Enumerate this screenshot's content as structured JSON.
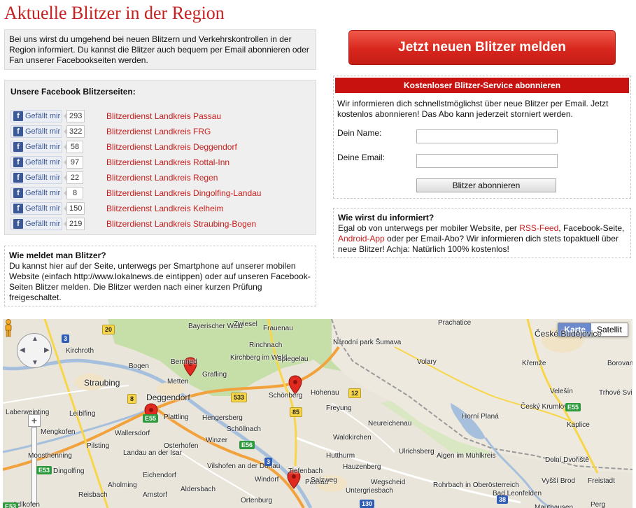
{
  "page": {
    "title": "Aktuelle Blitzer in der Region",
    "intro": "Bei uns wirst du umgehend bei neuen Blitzern und Verkehrskontrollen in der Region informiert. Du kannst die Blitzer auch bequem per Email abonnieren oder Fan unserer Facebookseiten werden."
  },
  "facebook": {
    "heading": "Unsere Facebook Blitzerseiten:",
    "like_label": "Gefällt mir",
    "pages": [
      {
        "count": "293",
        "name": "Blitzerdienst Landkreis Passau"
      },
      {
        "count": "322",
        "name": "Blitzerdienst Landkreis FRG"
      },
      {
        "count": "58",
        "name": "Blitzerdienst Landkreis Deggendorf"
      },
      {
        "count": "97",
        "name": "Blitzerdienst Landkreis Rottal-Inn"
      },
      {
        "count": "22",
        "name": "Blitzerdienst Landkreis Regen"
      },
      {
        "count": "8",
        "name": "Blitzerdienst Landkreis Dingolfing-Landau"
      },
      {
        "count": "150",
        "name": "Blitzerdienst Landkreis Kelheim"
      },
      {
        "count": "219",
        "name": "Blitzerdienst Landkreis Straubing-Bogen"
      }
    ]
  },
  "how_report": {
    "heading": "Wie meldet man Blitzer?",
    "text": "Du kannst hier auf der Seite, unterwegs per Smartphone auf unserer mobilen Website (einfach http://www.lokalnews.de eintippen) oder auf unseren Facebook-Seiten Blitzer melden. Die Blitzer werden nach einer kurzen Prüfung freigeschaltet."
  },
  "report_button": "Jetzt neuen Blitzer melden",
  "subscribe": {
    "header": "Kostenloser Blitzer-Service abonnieren",
    "text": "Wir informieren dich schnellstmöglichst über neue Blitzer per Email. Jetzt kostenlos abonnieren! Das Abo kann jederzeit storniert werden.",
    "name_label": "Dein Name:",
    "email_label": "Deine Email:",
    "name_value": "",
    "email_value": "",
    "button": "Blitzer abonnieren"
  },
  "info": {
    "heading": "Wie wirst du informiert?",
    "text_1": "Egal ob von unterwegs per mobiler Website, per ",
    "link_rss": "RSS-Feed",
    "text_2": ", Facebook-Seite, ",
    "link_app": "Android-App",
    "text_3": " oder per Email-Abo? Wir informieren dich stets topaktuell über neue Blitzer! Achja: Natürlich 100% kostenlos!"
  },
  "map": {
    "type_map": "Karte",
    "type_satellite": "Satellit",
    "places": [
      "Straubing",
      "Deggendorf",
      "Passau",
      "Bogen",
      "Kirchroth",
      "Bayerischer Wald",
      "Zwiesel",
      "Frauenau",
      "Rinchnach",
      "Kirchberg im Wald",
      "Spiegelau",
      "Grafling",
      "Bernried",
      "Metten",
      "Schönberg",
      "Hohenau",
      "Freyung",
      "Plattling",
      "Hengersberg",
      "Schöllnach",
      "Winzer",
      "Osterhofen",
      "Wallersdorf",
      "Landau an der Isar",
      "Eichendorf",
      "Dingolfing",
      "Pilsting",
      "Mengkofen",
      "Leiblfing",
      "Laberweinting",
      "Moosthenning",
      "Vilshofen an der Donau",
      "Windorf",
      "Tiefenbach",
      "Salzweg",
      "Hutthurm",
      "Waldkirchen",
      "Hauzenberg",
      "Wegscheid",
      "Untergriesbach",
      "Neureichenau",
      "Ortenburg",
      "Aldersbach",
      "Arnstorf",
      "Reisbach",
      "Adlkofen",
      "Aholming",
      "Národní park Šumava",
      "Volary",
      "Prachatice",
      "České Budějovice",
      "Český Krumlov",
      "Křemže",
      "Velešín",
      "Kaplice",
      "Horní Planá",
      "Trhové Sviny",
      "Borovany",
      "Dolní Dvořiště",
      "Vyšší Brod",
      "Freistadt",
      "Aigen im Mühlkreis",
      "Ulrichsberg",
      "Rohrbach in Oberösterreich",
      "Perg",
      "Mauthausen",
      "Bad Leonfelden"
    ],
    "roads": [
      "3",
      "20",
      "8",
      "E53",
      "533",
      "12",
      "85",
      "E56",
      "3",
      "130",
      "38",
      "E55",
      "E55",
      "E53"
    ]
  }
}
